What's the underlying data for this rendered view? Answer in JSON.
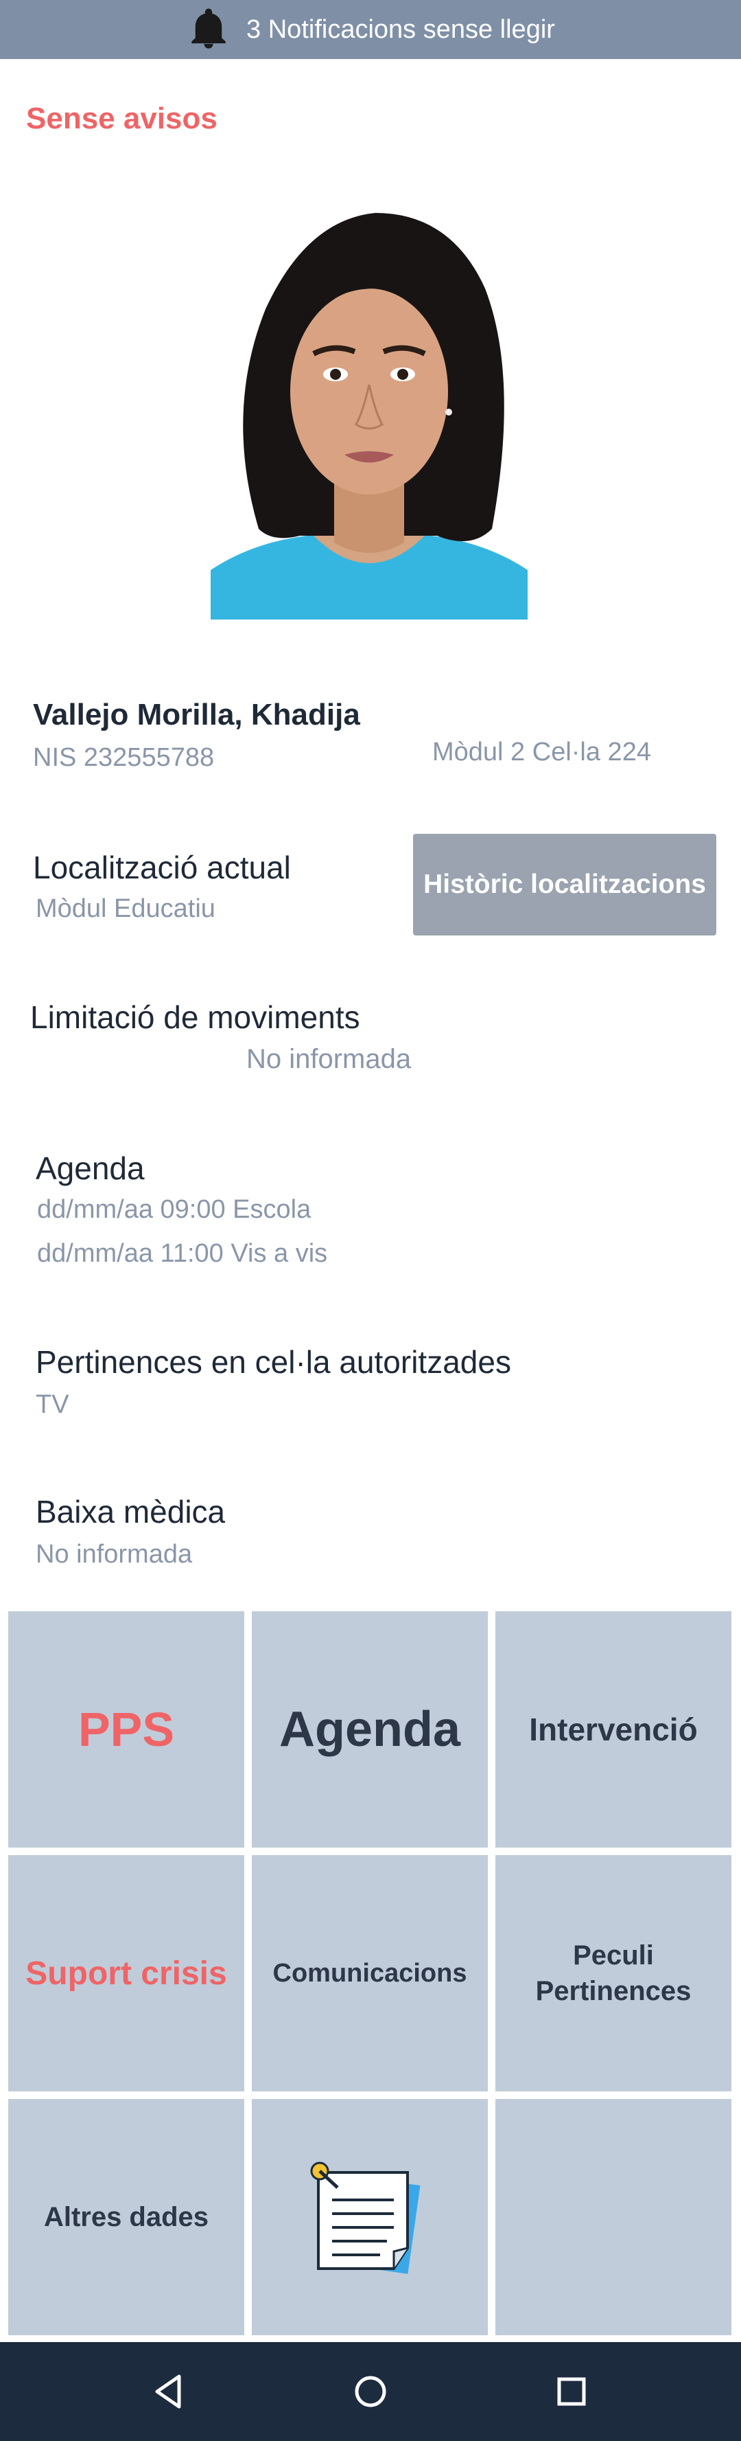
{
  "notifications": {
    "text": "3 Notificacions sense llegir"
  },
  "alerts": {
    "text": "Sense avisos"
  },
  "inmate": {
    "name": "Vallejo Morilla, Khadija",
    "nis": "NIS 232555788",
    "module": "Mòdul 2 Cel·la 224"
  },
  "location": {
    "label": "Localització actual",
    "value": "Mòdul Educatiu",
    "history_button": "Històric localitzacions"
  },
  "movement": {
    "label": "Limitació de moviments",
    "value": "No informada"
  },
  "agenda": {
    "label": "Agenda",
    "items": [
      "dd/mm/aa 09:00 Escola",
      "dd/mm/aa 11:00 Vis a vis"
    ]
  },
  "belongings": {
    "label": "Pertinences en cel·la autoritzades",
    "value": "TV"
  },
  "sick_leave": {
    "label": "Baixa mèdica",
    "value": "No informada"
  },
  "tiles": {
    "pps": "PPS",
    "agenda": "Agenda",
    "intervencio": "Intervenció",
    "suport": "Suport crisis",
    "comunicacions": "Comunicacions",
    "peculi_line1": "Peculi",
    "peculi_line2": "Pertinences",
    "altres": "Altres dades",
    "notes_icon": "notepad-icon"
  },
  "colors": {
    "topbar": "#7f90a6",
    "alert": "#ef6466",
    "tile": "#c0ccd9",
    "navbar": "#1d2b3f",
    "button": "#9aa3af"
  }
}
